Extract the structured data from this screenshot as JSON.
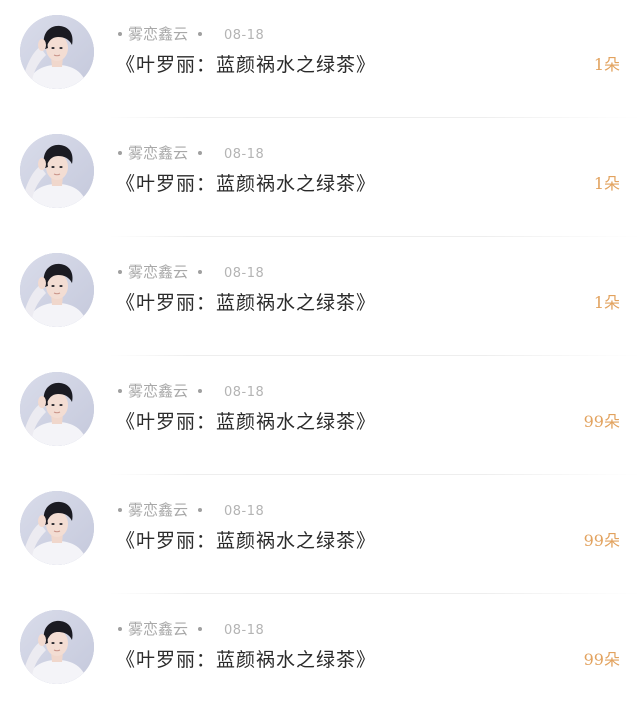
{
  "gifts": [
    {
      "user": "雾恋鑫云",
      "date": "08-18",
      "title": "《叶罗丽：蓝颜祸水之绿茶》",
      "amount": "1朵"
    },
    {
      "user": "雾恋鑫云",
      "date": "08-18",
      "title": "《叶罗丽：蓝颜祸水之绿茶》",
      "amount": "1朵"
    },
    {
      "user": "雾恋鑫云",
      "date": "08-18",
      "title": "《叶罗丽：蓝颜祸水之绿茶》",
      "amount": "1朵"
    },
    {
      "user": "雾恋鑫云",
      "date": "08-18",
      "title": "《叶罗丽：蓝颜祸水之绿茶》",
      "amount": "99朵"
    },
    {
      "user": "雾恋鑫云",
      "date": "08-18",
      "title": "《叶罗丽：蓝颜祸水之绿茶》",
      "amount": "99朵"
    },
    {
      "user": "雾恋鑫云",
      "date": "08-18",
      "title": "《叶罗丽：蓝颜祸水之绿茶》",
      "amount": "99朵"
    }
  ],
  "colors": {
    "accent": "#e2a25e",
    "text": "#2a2a2a",
    "muted": "#a8a8a8"
  },
  "icons": {
    "avatar": "user-avatar-photo",
    "separator": "dot-icon"
  }
}
